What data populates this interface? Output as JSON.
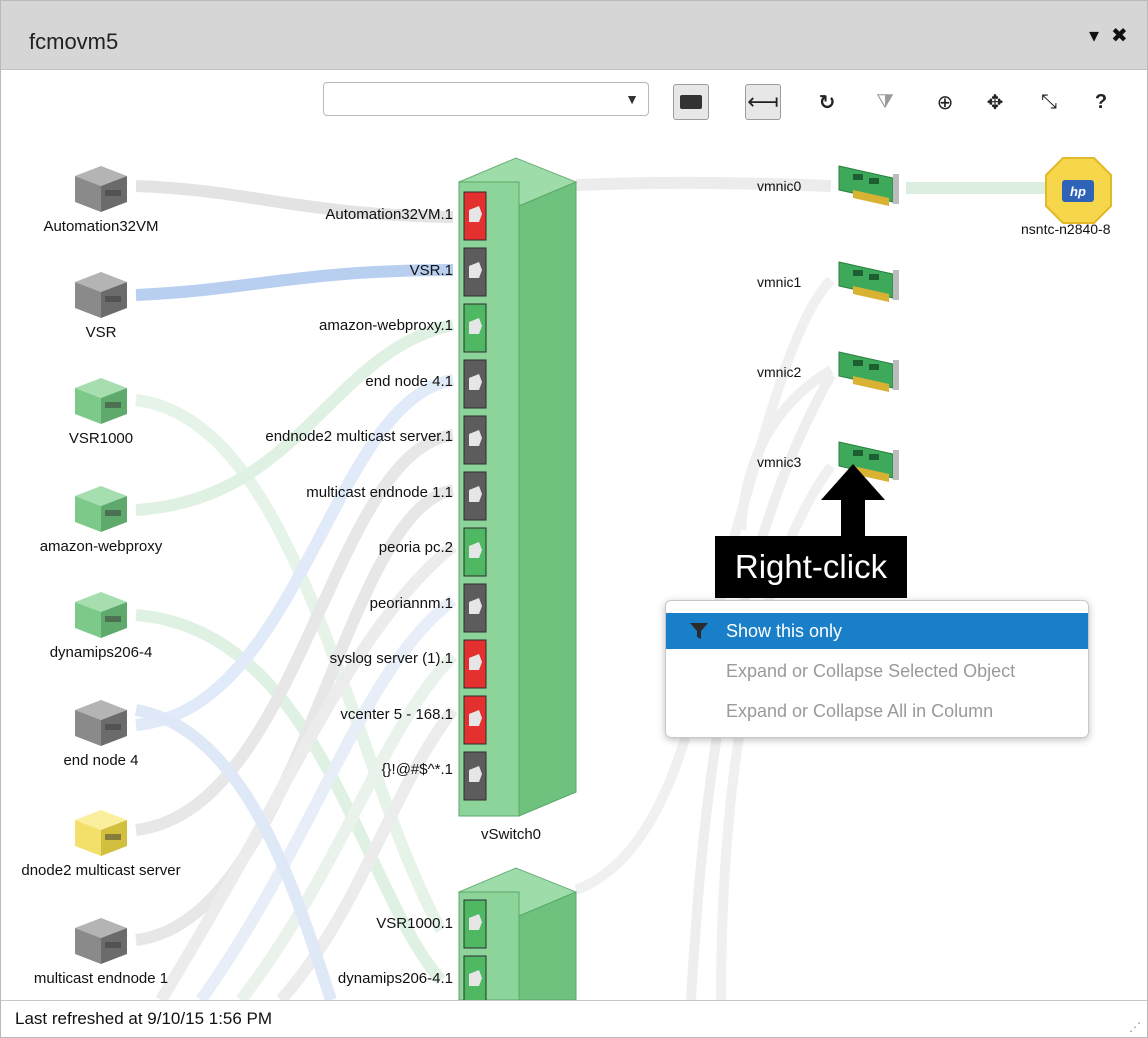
{
  "window": {
    "title": "fcmovm5",
    "menu_icon": "dropdown-icon",
    "close_icon": "close-icon"
  },
  "toolbar": {
    "filter_select": {
      "value": ""
    },
    "tools": [
      {
        "name": "annotation-toggle-icon",
        "glyph": "💬"
      },
      {
        "name": "connector-toggle-icon",
        "glyph": "⏏"
      },
      {
        "name": "refresh-icon",
        "glyph": "↻"
      },
      {
        "name": "clear-filter-icon",
        "glyph": "⧩"
      },
      {
        "name": "navigate-icon",
        "glyph": "⊕"
      },
      {
        "name": "move-icon",
        "glyph": "✥"
      },
      {
        "name": "collapse-icon",
        "glyph": "⤡"
      },
      {
        "name": "help-icon",
        "glyph": "?"
      }
    ]
  },
  "vms": [
    {
      "label": "Automation32VM",
      "color": "gray"
    },
    {
      "label": "VSR",
      "color": "gray"
    },
    {
      "label": "VSR1000",
      "color": "green"
    },
    {
      "label": "amazon-webproxy",
      "color": "green"
    },
    {
      "label": "dynamips206-4",
      "color": "green"
    },
    {
      "label": "end node 4",
      "color": "gray"
    },
    {
      "label": "dnode2 multicast server",
      "color": "yellow"
    },
    {
      "label": "multicast endnode 1",
      "color": "gray"
    }
  ],
  "vswitch0": {
    "label": "vSwitch0",
    "ports": [
      {
        "label": "Automation32VM.1",
        "status": "red"
      },
      {
        "label": "VSR.1",
        "status": "gray"
      },
      {
        "label": "amazon-webproxy.1",
        "status": "green"
      },
      {
        "label": "end node 4.1",
        "status": "gray"
      },
      {
        "label": "endnode2 multicast server.1",
        "status": "gray"
      },
      {
        "label": "multicast endnode 1.1",
        "status": "gray"
      },
      {
        "label": "peoria pc.2",
        "status": "green"
      },
      {
        "label": "peoriannm.1",
        "status": "gray"
      },
      {
        "label": "syslog server (1).1",
        "status": "red"
      },
      {
        "label": "vcenter 5 - 168.1",
        "status": "red"
      },
      {
        "label": "{}!@#$^*.1",
        "status": "gray"
      }
    ]
  },
  "vswitch1": {
    "ports": [
      {
        "label": "VSR1000.1",
        "status": "green"
      },
      {
        "label": "dynamips206-4.1",
        "status": "green"
      }
    ]
  },
  "nics": [
    "vmnic0",
    "vmnic1",
    "vmnic2",
    "vmnic3"
  ],
  "host": {
    "label": "nsntc-n2840-8",
    "logo": "hp"
  },
  "callout": {
    "text": "Right-click"
  },
  "context_menu": {
    "items": [
      {
        "label": "Show this only",
        "active": true
      },
      {
        "label": "Expand or Collapse Selected Object",
        "active": false
      },
      {
        "label": "Expand or Collapse All in Column",
        "active": false
      }
    ]
  },
  "status": {
    "text": "Last refreshed at 9/10/15 1:56 PM"
  },
  "colors": {
    "vm_gray": "#8a8a8a",
    "vm_green": "#7cc98a",
    "vm_yellow": "#f3e06a",
    "switch_green": "#8dd49a",
    "port_red": "#e53030",
    "port_gray": "#5c5c5c",
    "port_green": "#4fb863",
    "menu_highlight": "#1a7fc9",
    "link_gray": "#e4e4e4",
    "link_blue": "#bcd2ee",
    "link_green": "#d6eedb"
  }
}
